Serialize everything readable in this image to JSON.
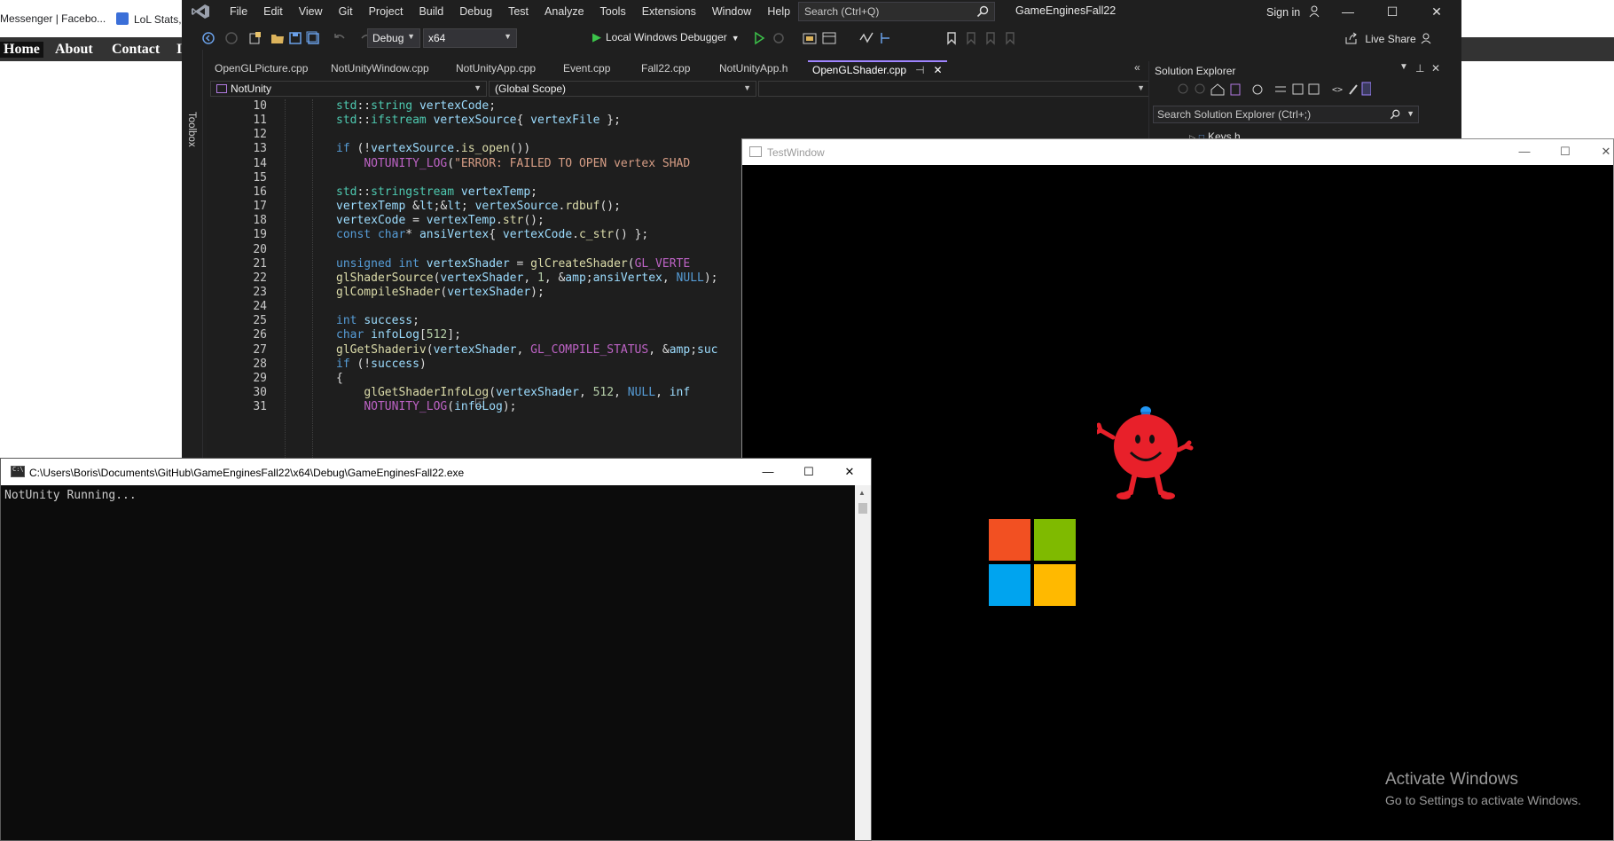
{
  "browser": {
    "bookmarks": [
      {
        "label": "Messenger | Facebo..."
      },
      {
        "label": "LoL Stats,"
      }
    ],
    "nav": [
      {
        "label": "Home"
      },
      {
        "label": "About"
      },
      {
        "label": "Contact"
      },
      {
        "label": "I"
      }
    ]
  },
  "vs": {
    "menu": [
      "File",
      "Edit",
      "View",
      "Git",
      "Project",
      "Build",
      "Debug",
      "Test",
      "Analyze",
      "Tools",
      "Extensions",
      "Window",
      "Help"
    ],
    "search_placeholder": "Search (Ctrl+Q)",
    "project_name": "GameEnginesFall22",
    "sign_in": "Sign in",
    "live_share": "Live Share",
    "config": "Debug",
    "platform": "x64",
    "run_label": "Local Windows Debugger",
    "toolbox_label": "Toolbox",
    "tabs": [
      {
        "label": "OpenGLPicture.cpp"
      },
      {
        "label": "NotUnityWindow.cpp"
      },
      {
        "label": "NotUnityApp.cpp"
      },
      {
        "label": "Event.cpp"
      },
      {
        "label": "Fall22.cpp"
      },
      {
        "label": "NotUnityApp.h"
      },
      {
        "label": "OpenGLShader.cpp"
      }
    ],
    "nav_project": "NotUnity",
    "nav_scope": "(Global Scope)",
    "code_lines": [
      {
        "num": "10",
        "text": "std::string vertexCode;"
      },
      {
        "num": "11",
        "text": "std::ifstream vertexSource{ vertexFile };"
      },
      {
        "num": "12",
        "text": ""
      },
      {
        "num": "13",
        "text": "if (!vertexSource.is_open())"
      },
      {
        "num": "14",
        "text": "    NOTUNITY_LOG(\"ERROR: FAILED TO OPEN vertex SHAD"
      },
      {
        "num": "15",
        "text": ""
      },
      {
        "num": "16",
        "text": "std::stringstream vertexTemp;"
      },
      {
        "num": "17",
        "text": "vertexTemp << vertexSource.rdbuf();"
      },
      {
        "num": "18",
        "text": "vertexCode = vertexTemp.str();"
      },
      {
        "num": "19",
        "text": "const char* ansiVertex{ vertexCode.c_str() };"
      },
      {
        "num": "20",
        "text": ""
      },
      {
        "num": "21",
        "text": "unsigned int vertexShader = glCreateShader(GL_VERTE"
      },
      {
        "num": "22",
        "text": "glShaderSource(vertexShader, 1, &ansiVertex, NULL);"
      },
      {
        "num": "23",
        "text": "glCompileShader(vertexShader);"
      },
      {
        "num": "24",
        "text": ""
      },
      {
        "num": "25",
        "text": "int success;"
      },
      {
        "num": "26",
        "text": "char infoLog[512];"
      },
      {
        "num": "27",
        "text": "glGetShaderiv(vertexShader, GL_COMPILE_STATUS, &suc"
      },
      {
        "num": "28",
        "text": "if (!success)"
      },
      {
        "num": "29",
        "text": "{"
      },
      {
        "num": "30",
        "text": "    glGetShaderInfoLog(vertexShader, 512, NULL, inf"
      },
      {
        "num": "31",
        "text": "    NOTUNITY_LOG(infoLog);"
      }
    ],
    "solution_explorer": {
      "title": "Solution Explorer",
      "search_placeholder": "Search Solution Explorer (Ctrl+;)",
      "visible_item": "Keys.h"
    }
  },
  "test_window": {
    "title": "TestWindow"
  },
  "console": {
    "title": "C:\\Users\\Boris\\Documents\\GitHub\\GameEnginesFall22\\x64\\Debug\\GameEnginesFall22.exe",
    "output": "NotUnity Running..."
  },
  "activation": {
    "line1": "Activate Windows",
    "line2": "Go to Settings to activate Windows."
  },
  "colors": {
    "ms_red": "#f25022",
    "ms_green": "#7fba00",
    "ms_blue": "#00a4ef",
    "ms_yellow": "#ffb900",
    "mr_tickle_red": "#e8202a",
    "vs_accent": "#9f84ff"
  }
}
